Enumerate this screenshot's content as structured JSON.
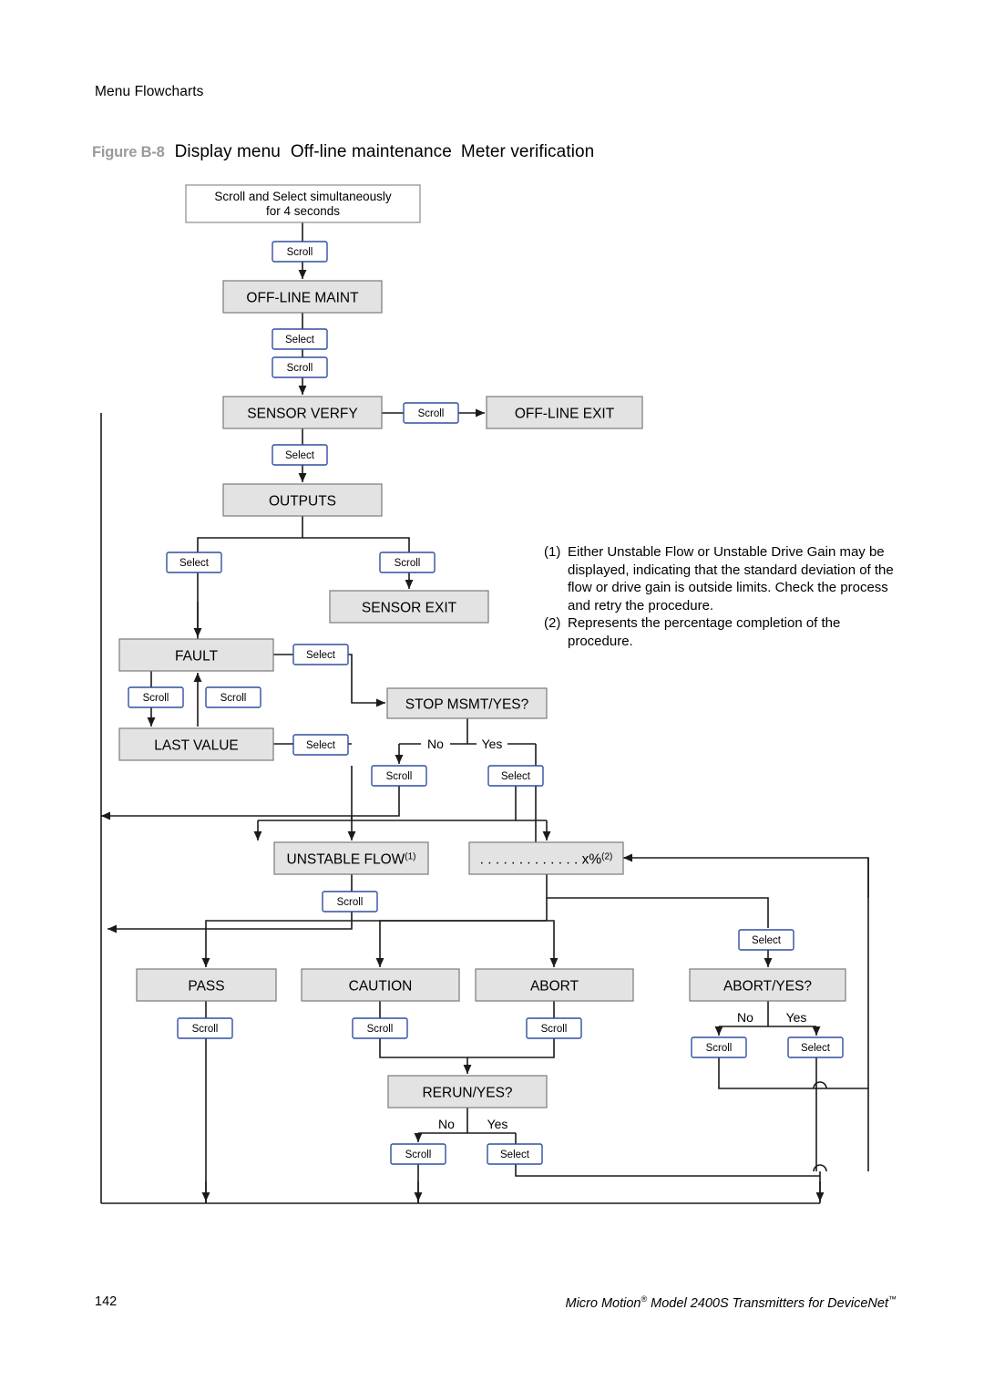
{
  "running_head": "Menu Flowcharts",
  "figure": {
    "number": "Figure B-8",
    "part1": "Display menu",
    "part2": "Off-line maintenance",
    "part3": "Meter verification"
  },
  "notes": [
    {
      "mark": "(1)",
      "text": "Either Unstable Flow or Unstable Drive Gain may be displayed, indicating that the standard deviation of the flow or drive gain is outside limits. Check the process and retry the procedure."
    },
    {
      "mark": "(2)",
      "text": "Represents the percentage completion of the procedure."
    }
  ],
  "footer": {
    "page_number": "142",
    "meta_pre": "Micro Motion",
    "meta_reg": "®",
    "meta_mid": " Model 2400S Transmitters for DeviceNet",
    "meta_tm": "™"
  },
  "colors": {
    "node_fill": "#e3e3e3",
    "node_stroke": "#7a7a7a",
    "key_stroke": "#2f4f9f",
    "key_fill": "#ffffff",
    "line": "#1a1a1a",
    "figure_number": "#9a9a9a"
  },
  "flowchart": {
    "nodes": [
      {
        "id": "start",
        "label": "Scroll  and Select  simultaneously",
        "label2": "for 4 seconds",
        "type": "plain"
      },
      {
        "id": "offline_maint",
        "label": "OFF-LINE MAINT",
        "type": "screen"
      },
      {
        "id": "sensor_verfy",
        "label": "SENSOR VERFY",
        "type": "screen"
      },
      {
        "id": "offline_exit",
        "label": "OFF-LINE EXIT",
        "type": "screen"
      },
      {
        "id": "outputs",
        "label": "OUTPUTS",
        "type": "screen"
      },
      {
        "id": "sensor_exit",
        "label": "SENSOR EXIT",
        "type": "screen"
      },
      {
        "id": "fault",
        "label": "FAULT",
        "type": "screen"
      },
      {
        "id": "last_value",
        "label": "LAST VALUE",
        "type": "screen"
      },
      {
        "id": "stop_msmt",
        "label": "STOP MSMT/YES?",
        "type": "screen"
      },
      {
        "id": "unstable_flow",
        "label": "UNSTABLE FLOW",
        "sup": "(1)",
        "type": "screen"
      },
      {
        "id": "progress",
        "label": ". . . . . . . . . . . . . x%",
        "sup": "(2)",
        "type": "screen"
      },
      {
        "id": "pass",
        "label": "PASS",
        "type": "screen"
      },
      {
        "id": "caution",
        "label": "CAUTION",
        "type": "screen"
      },
      {
        "id": "abort",
        "label": "ABORT",
        "type": "screen"
      },
      {
        "id": "abort_yes",
        "label": "ABORT/YES?",
        "type": "screen"
      },
      {
        "id": "rerun_yes",
        "label": "RERUN/YES?",
        "type": "screen"
      }
    ],
    "keys": [
      {
        "id": "k1",
        "label": "Scroll"
      },
      {
        "id": "k2",
        "label": "Select"
      },
      {
        "id": "k3",
        "label": "Scroll"
      },
      {
        "id": "k4",
        "label": "Scroll"
      },
      {
        "id": "k5",
        "label": "Select"
      },
      {
        "id": "k6",
        "label": "Select"
      },
      {
        "id": "k7",
        "label": "Scroll"
      },
      {
        "id": "k8",
        "label": "Select"
      },
      {
        "id": "k9",
        "label": "Scroll"
      },
      {
        "id": "k10",
        "label": "Scroll"
      },
      {
        "id": "k11",
        "label": "Select"
      },
      {
        "id": "k12",
        "label": "Scroll"
      },
      {
        "id": "k13",
        "label": "Select"
      },
      {
        "id": "k14",
        "label": "Scroll"
      },
      {
        "id": "k15",
        "label": "Select"
      },
      {
        "id": "k16",
        "label": "Scroll"
      },
      {
        "id": "k17",
        "label": "Scroll"
      },
      {
        "id": "k18",
        "label": "Scroll"
      },
      {
        "id": "k19",
        "label": "Scroll"
      },
      {
        "id": "k20",
        "label": "Select"
      },
      {
        "id": "k21",
        "label": "Scroll"
      },
      {
        "id": "k22",
        "label": "Select"
      }
    ],
    "branch_labels": [
      {
        "id": "b1",
        "no": "No",
        "yes": "Yes"
      },
      {
        "id": "b2",
        "no": "No",
        "yes": "Yes"
      },
      {
        "id": "b3",
        "no": "No",
        "yes": "Yes"
      }
    ]
  }
}
